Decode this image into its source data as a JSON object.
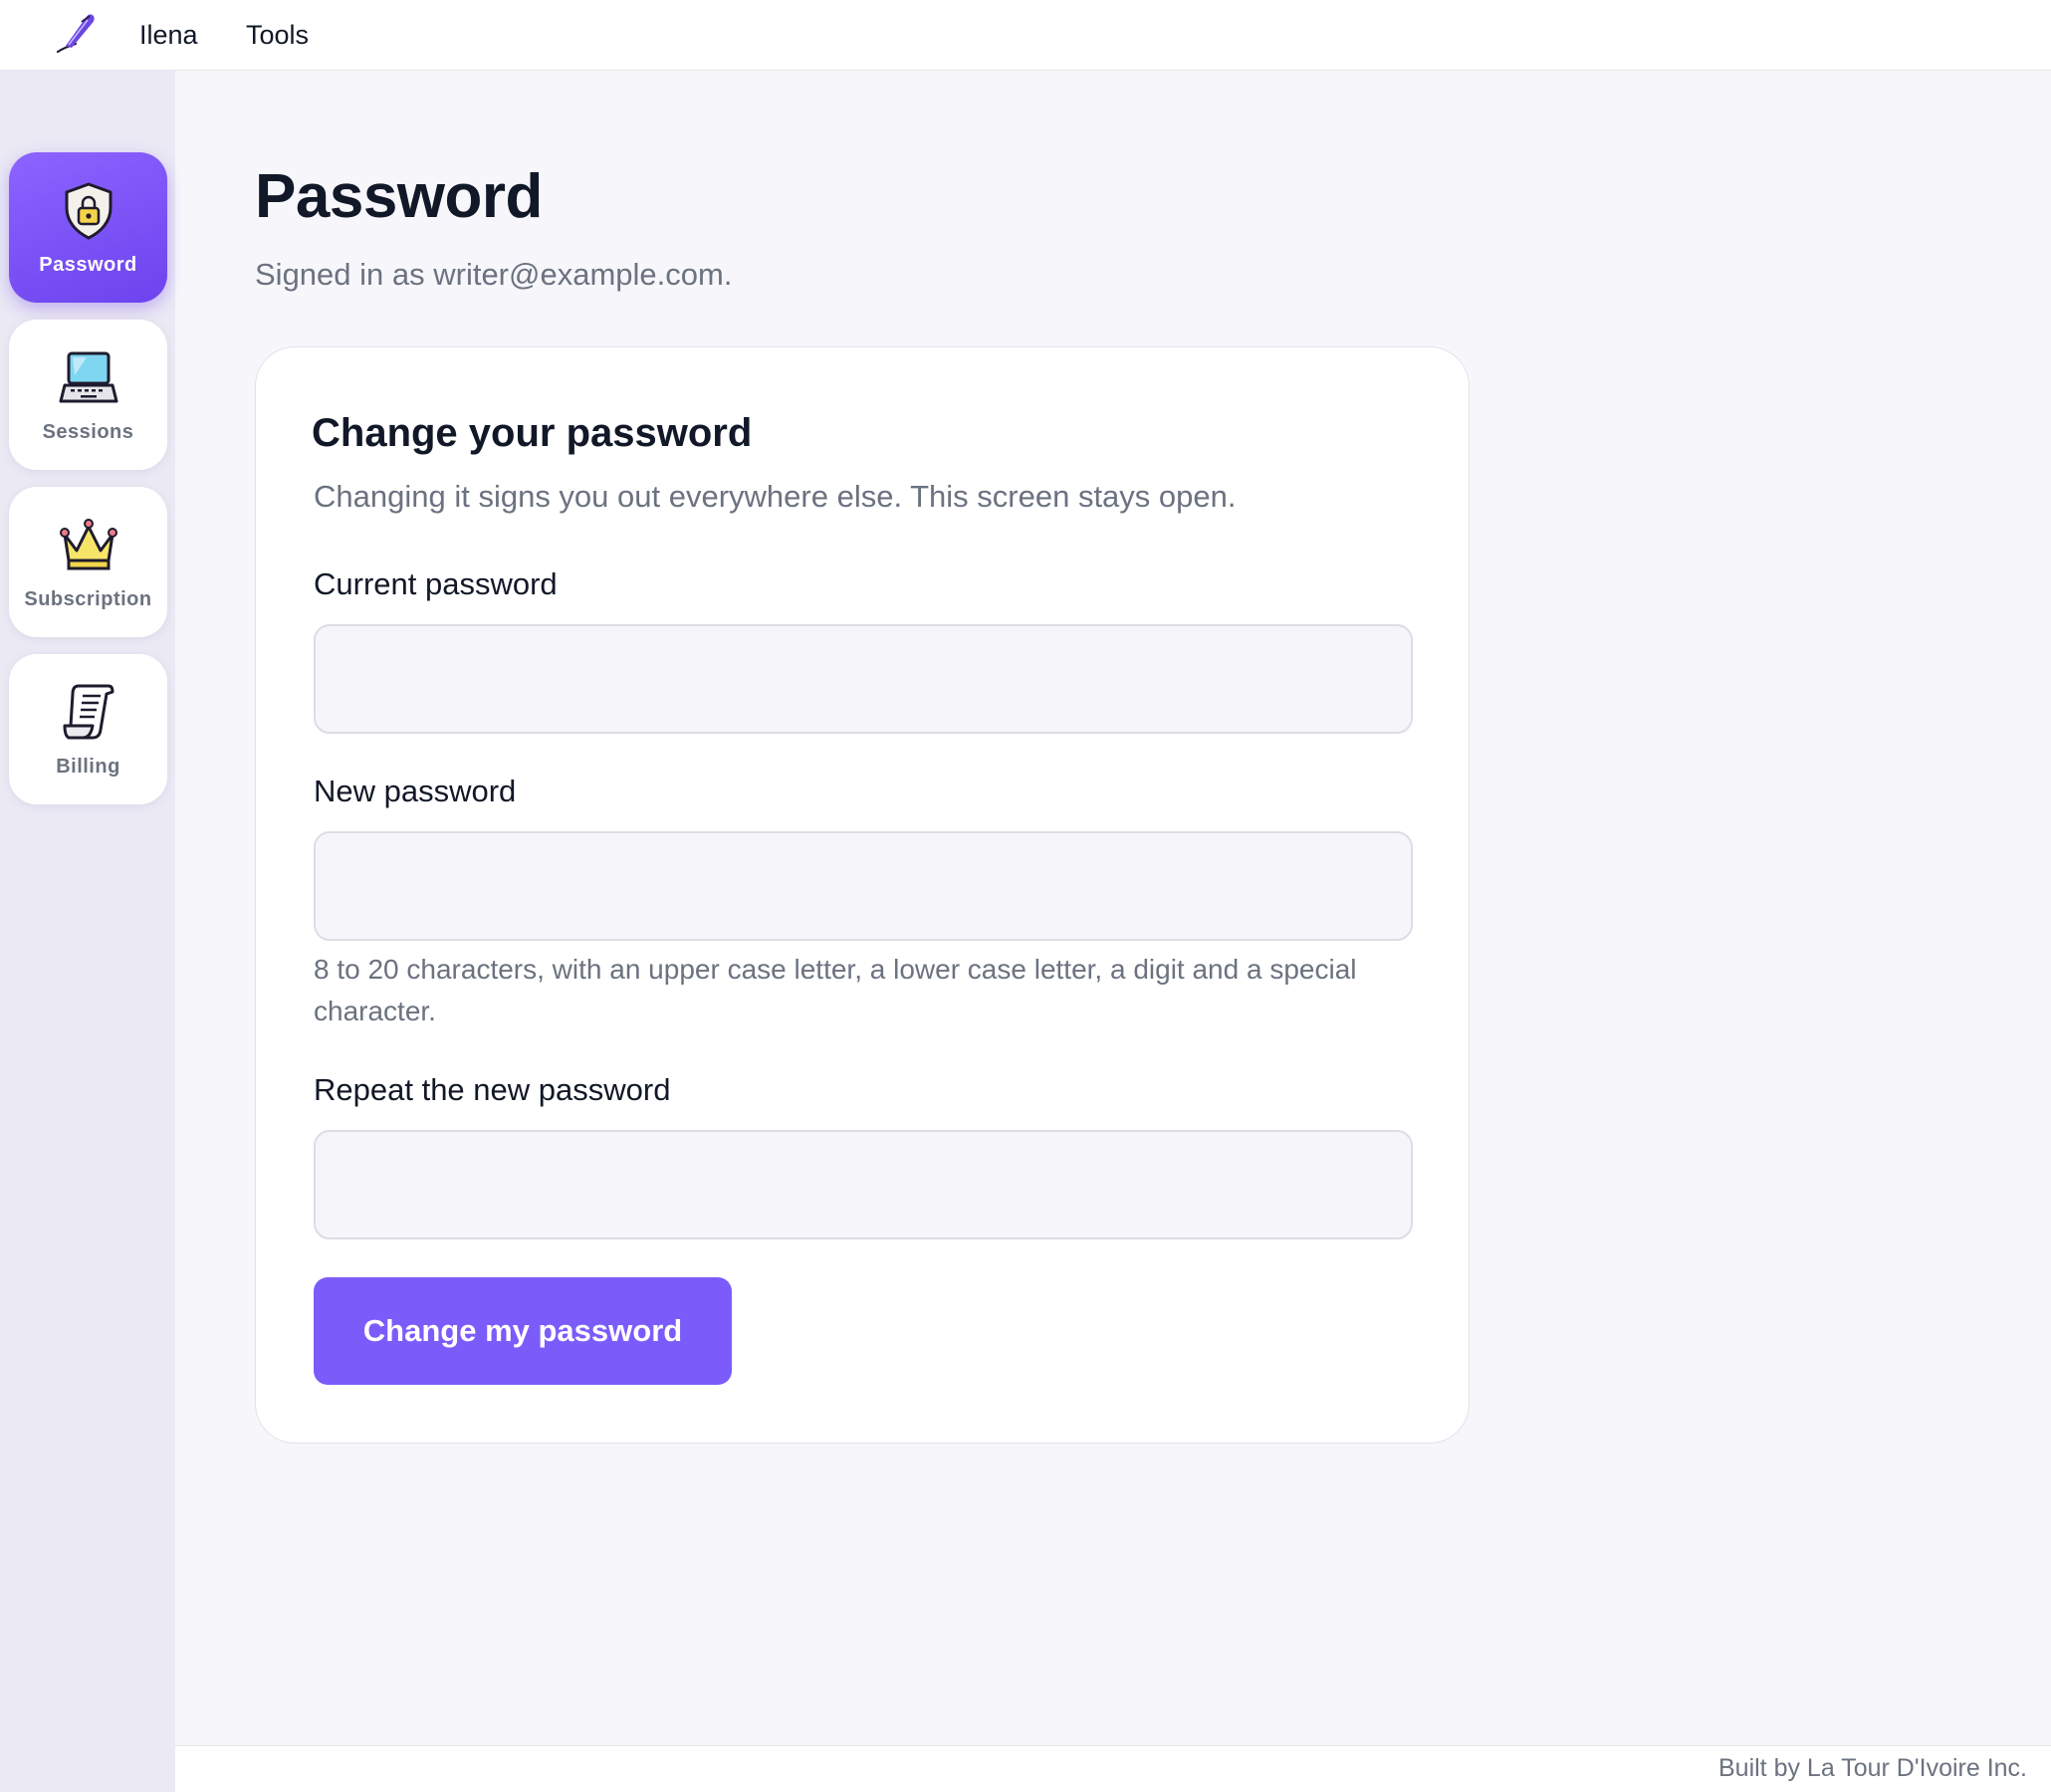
{
  "topbar": {
    "brand": "Ilena",
    "tools": "Tools",
    "logo_icon": "quill-pen-icon"
  },
  "sidebar": {
    "items": [
      {
        "label": "Password",
        "icon": "shield-lock-icon",
        "active": true
      },
      {
        "label": "Sessions",
        "icon": "laptop-icon",
        "active": false
      },
      {
        "label": "Subscription",
        "icon": "crown-icon",
        "active": false
      },
      {
        "label": "Billing",
        "icon": "receipt-scroll-icon",
        "active": false
      }
    ]
  },
  "main": {
    "title": "Password",
    "subtitle": "Signed in as writer@example.com."
  },
  "card": {
    "title": "Change your password",
    "description": "Changing it signs you out everywhere else. This screen stays open.",
    "fields": {
      "current": {
        "label": "Current password",
        "value": ""
      },
      "new": {
        "label": "New password",
        "value": "",
        "hint": "8 to 20 characters, with an upper case letter, a lower case letter, a digit and a special character."
      },
      "repeat": {
        "label": "Repeat the new password",
        "value": ""
      }
    },
    "submit_label": "Change my password"
  },
  "footer": {
    "text": "Built by La Tour D'Ivoire Inc."
  },
  "colors": {
    "accent": "#7b5cfa",
    "sidebar_bg": "#ebe9f4",
    "page_bg": "#f7f7fb"
  }
}
